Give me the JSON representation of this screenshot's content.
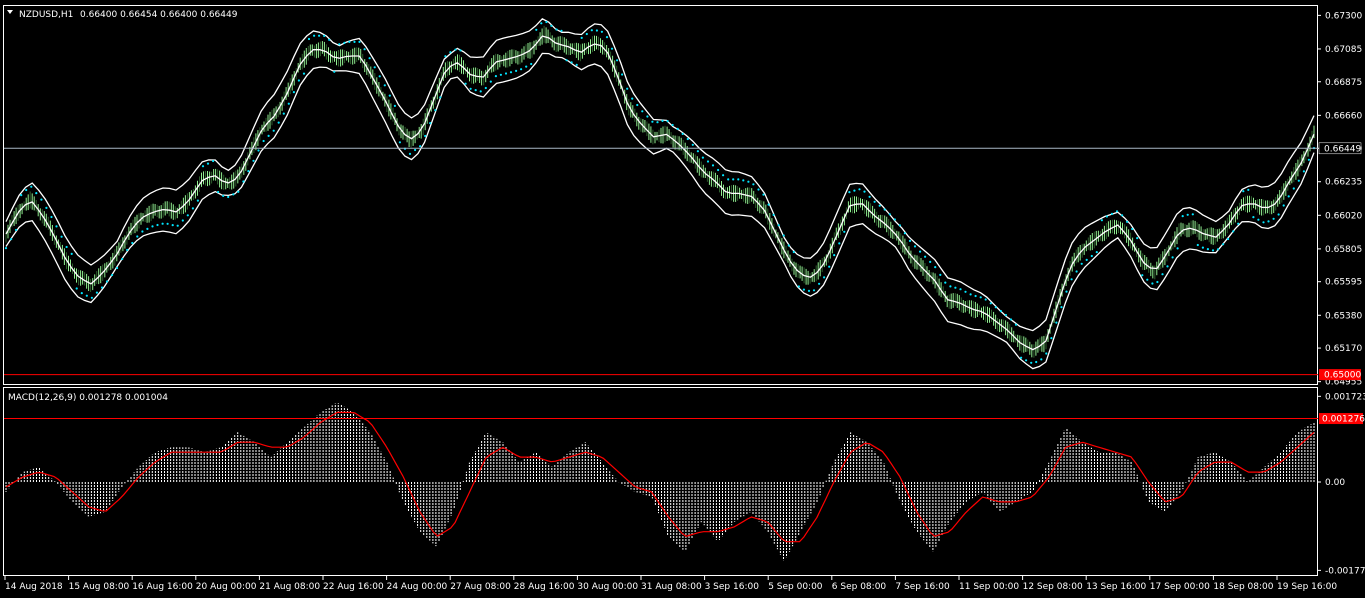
{
  "main_chart": {
    "symbol_label": "NZDUSD,H1",
    "ohlc_label": "0.66400 0.66454 0.66400 0.66449",
    "current_price_label": "0.66449",
    "level_price_label": "0.65000"
  },
  "macd_panel": {
    "label": "MACD(12,26,9) 0.001278 0.001004",
    "current_value_label": "0.001276"
  },
  "x_axis_labels": [
    "14 Aug 2018",
    "15 Aug 08:00",
    "16 Aug 16:00",
    "20 Aug 00:00",
    "21 Aug 08:00",
    "22 Aug 16:00",
    "24 Aug 00:00",
    "27 Aug 08:00",
    "28 Aug 16:00",
    "30 Aug 00:00",
    "31 Aug 08:00",
    "3 Sep 16:00",
    "5 Sep 00:00",
    "6 Sep 08:00",
    "7 Sep 16:00",
    "11 Sep 00:00",
    "12 Sep 08:00",
    "13 Sep 16:00",
    "17 Sep 00:00",
    "18 Sep 08:00",
    "19 Sep 16:00"
  ],
  "colors": {
    "background": "#000000",
    "candle": "#90ee90",
    "candle_dark": "#2e5e2e",
    "bands": "#ffffff",
    "sar": "#00e5ff",
    "macd_hist": "#ffffff",
    "macd_signal": "#ff0000",
    "level_line": "#ff0000",
    "price_line": "#a9b7c6"
  },
  "chart_data": [
    {
      "type": "line",
      "title": "NZDUSD,H1",
      "y_tick_labels": [
        "0.67300",
        "0.67085",
        "0.66875",
        "0.66660",
        "0.66449",
        "0.66235",
        "0.66020",
        "0.65805",
        "0.65595",
        "0.65380",
        "0.65170",
        "0.64955"
      ],
      "ylim": [
        0.6494,
        0.6736
      ],
      "horizontal_lines": [
        0.66449,
        0.65
      ],
      "series": [
        {
          "values": [
            0.659,
            0.6604,
            0.6612,
            0.6602,
            0.6588,
            0.6572,
            0.6562,
            0.6558,
            0.6566,
            0.6576,
            0.659,
            0.66,
            0.6604,
            0.6606,
            0.6604,
            0.6612,
            0.6624,
            0.6628,
            0.6622,
            0.6626,
            0.6642,
            0.6658,
            0.6666,
            0.668,
            0.6698,
            0.6708,
            0.6708,
            0.6702,
            0.6704,
            0.6704,
            0.669,
            0.6676,
            0.666,
            0.665,
            0.6656,
            0.6676,
            0.6696,
            0.67,
            0.6692,
            0.669,
            0.67,
            0.6702,
            0.6704,
            0.6708,
            0.6718,
            0.6712,
            0.671,
            0.6706,
            0.6712,
            0.671,
            0.6692,
            0.667,
            0.666,
            0.6652,
            0.6654,
            0.6648,
            0.664,
            0.663,
            0.6624,
            0.6616,
            0.6616,
            0.6614,
            0.6606,
            0.659,
            0.6574,
            0.6564,
            0.6562,
            0.6572,
            0.659,
            0.6608,
            0.661,
            0.6602,
            0.6596,
            0.6588,
            0.6576,
            0.6568,
            0.656,
            0.6548,
            0.6546,
            0.6542,
            0.654,
            0.6534,
            0.6528,
            0.652,
            0.6516,
            0.652,
            0.6544,
            0.6568,
            0.658,
            0.6586,
            0.6592,
            0.6596,
            0.6586,
            0.6572,
            0.6566,
            0.6578,
            0.6592,
            0.6594,
            0.659,
            0.6588,
            0.6596,
            0.6608,
            0.661,
            0.6606,
            0.661,
            0.6624,
            0.6636,
            0.6654
          ]
        }
      ]
    },
    {
      "type": "bar",
      "title": "MACD(12,26,9)",
      "y_tick_labels": [
        "0.001723",
        "0.001276",
        "0.00",
        "-0.001777"
      ],
      "ylim": [
        -0.00185,
        0.00185
      ],
      "horizontal_lines": [
        0.001276
      ],
      "series": [
        {
          "name": "MACD",
          "values": [
            -0.0002,
            0.0002,
            0.0003,
            0.0,
            -0.0004,
            -0.0007,
            -0.0006,
            -0.0001,
            0.0003,
            0.0006,
            0.0007,
            0.0007,
            0.0006,
            0.0007,
            0.001,
            0.0008,
            0.0005,
            0.0008,
            0.0011,
            0.0014,
            0.0016,
            0.0014,
            0.001,
            0.0004,
            -0.0004,
            -0.001,
            -0.0013,
            -0.0006,
            0.0004,
            0.001,
            0.0008,
            0.0004,
            0.0006,
            0.0003,
            0.0006,
            0.0008,
            0.0004,
            0.0,
            -0.0002,
            -0.0003,
            -0.0011,
            -0.0014,
            -0.0008,
            -0.0012,
            -0.0008,
            -0.0006,
            -0.001,
            -0.0016,
            -0.001,
            -0.0004,
            0.0004,
            0.001,
            0.0008,
            0.0004,
            -0.0004,
            -0.001,
            -0.0014,
            -0.0008,
            -0.0004,
            -0.0002,
            -0.0006,
            -0.0004,
            -0.0002,
            0.0004,
            0.0011,
            0.0008,
            0.0006,
            0.0006,
            0.0004,
            -0.0004,
            -0.0006,
            -0.0002,
            0.0005,
            0.0006,
            0.0004,
            0.0,
            0.0003,
            0.0006,
            0.001,
            0.0012
          ]
        },
        {
          "name": "Signal",
          "values": [
            -0.0001,
            0.0001,
            0.0002,
            0.0001,
            -0.0002,
            -0.0005,
            -0.0006,
            -0.0003,
            0.0001,
            0.0004,
            0.0006,
            0.0006,
            0.0006,
            0.0006,
            0.0008,
            0.0008,
            0.0007,
            0.0007,
            0.0009,
            0.0012,
            0.0014,
            0.0014,
            0.0012,
            0.0007,
            0.0001,
            -0.0006,
            -0.0011,
            -0.0009,
            -0.0002,
            0.0005,
            0.0007,
            0.0005,
            0.0005,
            0.0004,
            0.0005,
            0.0006,
            0.0005,
            0.0002,
            -0.0001,
            -0.0002,
            -0.0007,
            -0.0011,
            -0.001,
            -0.001,
            -0.0009,
            -0.0007,
            -0.0008,
            -0.0012,
            -0.0012,
            -0.0007,
            0.0,
            0.0006,
            0.0008,
            0.0006,
            0.0001,
            -0.0006,
            -0.0011,
            -0.001,
            -0.0006,
            -0.0003,
            -0.0004,
            -0.0004,
            -0.0003,
            0.0001,
            0.0007,
            0.0008,
            0.0007,
            0.0006,
            0.0005,
            0.0,
            -0.0004,
            -0.0003,
            0.0002,
            0.0004,
            0.0004,
            0.0002,
            0.0002,
            0.0004,
            0.0007,
            0.001
          ]
        }
      ]
    }
  ]
}
